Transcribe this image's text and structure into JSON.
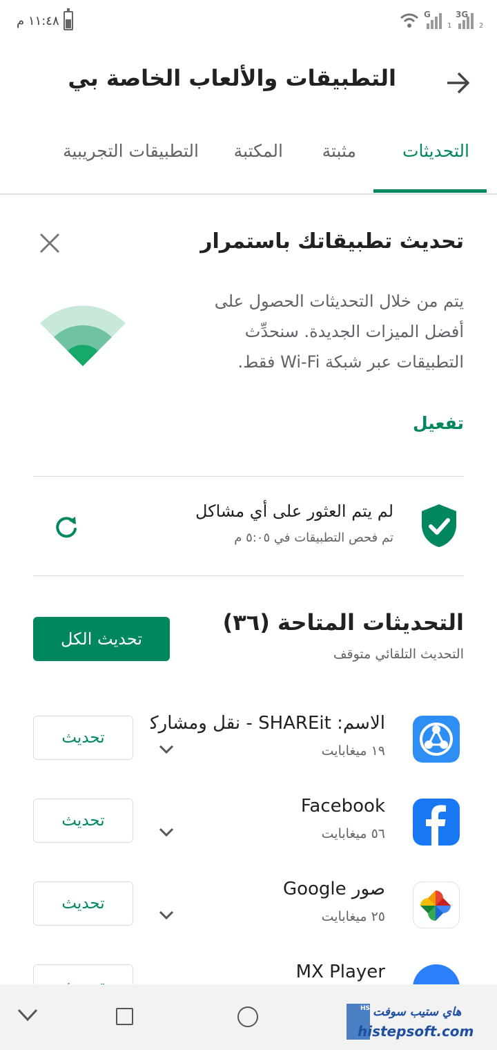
{
  "status_bar": {
    "time": "١١:٤٨ م",
    "network_1": "G",
    "network_2": "3G",
    "sim_1": "1",
    "sim_2": "2"
  },
  "header": {
    "title": "التطبيقات والألعاب الخاصة بي"
  },
  "tabs": [
    {
      "label": "التحديثات"
    },
    {
      "label": "مثبتة"
    },
    {
      "label": "المكتبة"
    },
    {
      "label": "التطبيقات التجريبية"
    }
  ],
  "auto_update_card": {
    "title": "تحديث تطبيقاتك باستمرار",
    "body": "يتم من خلال التحديثات الحصول على أفضل الميزات الجديدة. سنحدِّث التطبيقات عبر شبكة Wi-Fi فقط.",
    "action": "تفعيل"
  },
  "play_protect": {
    "title": "لم يتم العثور على أي مشاكل",
    "subtitle": "تم فحص التطبيقات في ٥:٠٥ م"
  },
  "updates": {
    "title": "التحديثات المتاحة (٣٦)",
    "subtitle": "التحديث التلقائي متوقف",
    "update_all_label": "تحديث الكل",
    "update_label": "تحديث",
    "apps": [
      {
        "name": "الاسم: SHAREit - نقل ومشاركة",
        "size": "١٩ ميغابايت"
      },
      {
        "name": "Facebook",
        "size": "٥٦ ميغابايت"
      },
      {
        "name": "صور Google",
        "size": "٢٥ ميغابايت"
      },
      {
        "name": "MX Player",
        "size": ""
      }
    ]
  },
  "watermark": {
    "box_text": "HS",
    "top": "هاي ستيب سوفت",
    "bottom": "histepsoft.com"
  },
  "colors": {
    "accent": "#01875f",
    "text_primary": "#202124",
    "text_secondary": "#5f6368"
  }
}
